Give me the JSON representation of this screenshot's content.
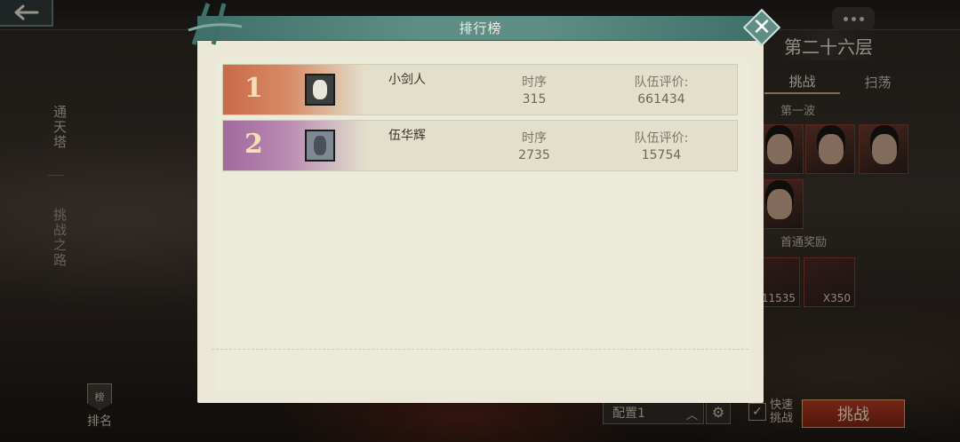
{
  "modal": {
    "title": "排行榜",
    "columns": {
      "order": "时序",
      "score": "队伍评价:"
    },
    "rows": [
      {
        "rank": "1",
        "name": "小剑人",
        "order": "315",
        "score": "661434"
      },
      {
        "rank": "2",
        "name": "伍华辉",
        "order": "2735",
        "score": "15754"
      }
    ]
  },
  "sidebar": {
    "tab_tower": "通天塔",
    "tab_challenge_road": "挑战之路",
    "rank_button": "排名",
    "rank_badge": "榜"
  },
  "right_panel": {
    "floor_title": "第二十六层",
    "tabs": [
      "挑战",
      "扫荡"
    ],
    "wave_label": "第一波",
    "reward_label": "首通奖励",
    "reward_counts": [
      "11535",
      "X350"
    ]
  },
  "bottom_bar": {
    "config_label": "配置1",
    "fast_label": "快速挑战",
    "challenge_button": "挑战"
  },
  "colors": {
    "modal_bg": "#ebe8d7",
    "header_teal": "#5f8e86",
    "rank1_accent": "#c86a4a",
    "rank2_accent": "#a06a9c",
    "challenge_red": "#b23a22"
  },
  "icons": [
    "back-arrow-icon",
    "chat-icon",
    "close-icon",
    "gear-icon",
    "check-icon",
    "chevron-up-icon"
  ]
}
